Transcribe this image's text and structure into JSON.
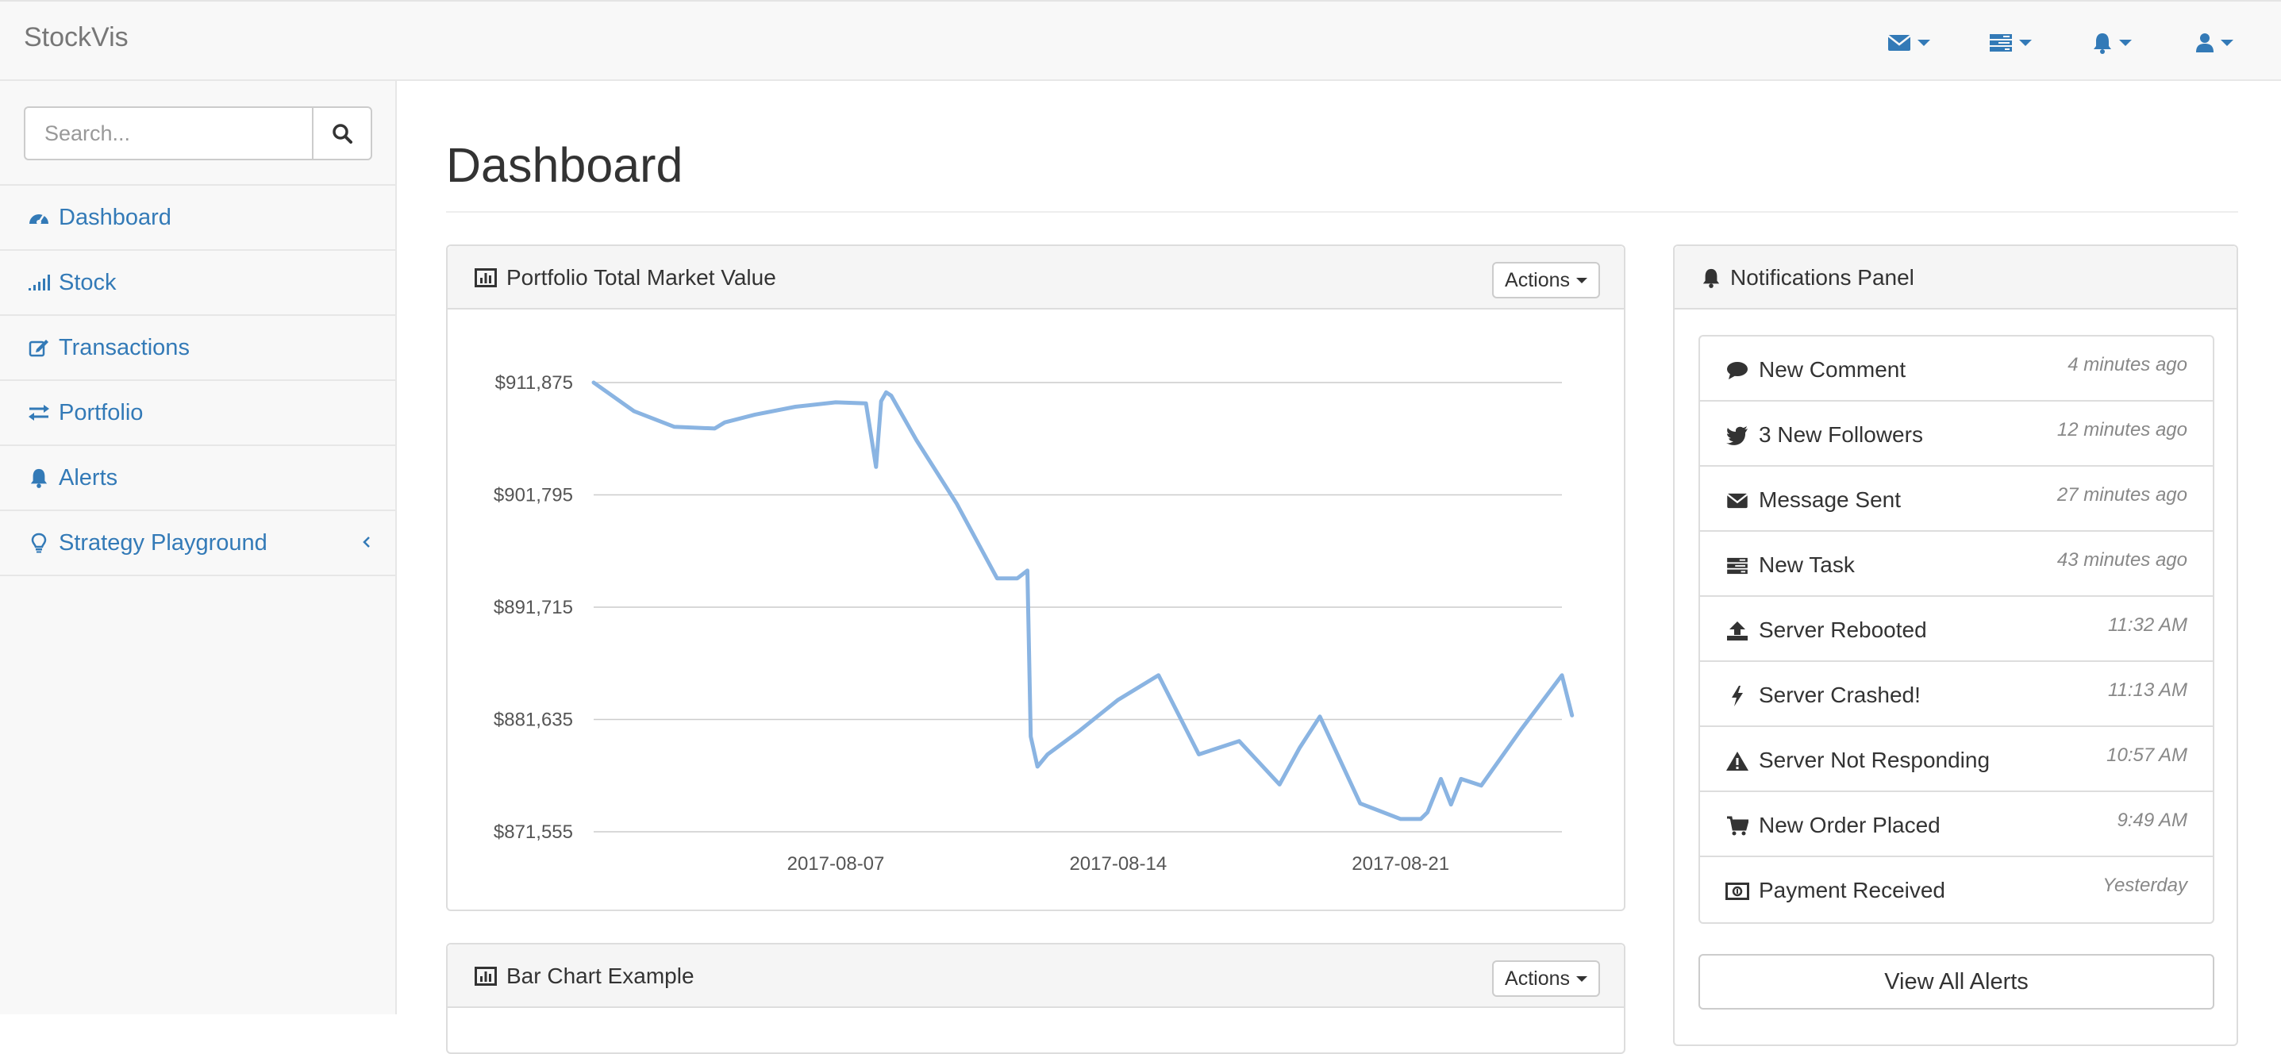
{
  "app": {
    "brand": "StockVis"
  },
  "navbar": {
    "menus": [
      {
        "icon": "envelope-icon"
      },
      {
        "icon": "tasks-icon"
      },
      {
        "icon": "bell-icon"
      },
      {
        "icon": "user-icon"
      }
    ]
  },
  "sidebar": {
    "search": {
      "placeholder": "Search...",
      "value": ""
    },
    "items": [
      {
        "label": "Dashboard",
        "icon": "dashboard-icon"
      },
      {
        "label": "Stock",
        "icon": "signal-icon"
      },
      {
        "label": "Transactions",
        "icon": "edit-icon"
      },
      {
        "label": "Portfolio",
        "icon": "exchange-icon"
      },
      {
        "label": "Alerts",
        "icon": "bell-icon"
      },
      {
        "label": "Strategy Playground",
        "icon": "lightbulb-icon",
        "collapsed_indicator": "chevron-left-icon"
      }
    ]
  },
  "main": {
    "page_title": "Dashboard",
    "panels": {
      "market_value": {
        "title": "Portfolio Total Market Value",
        "actions_label": "Actions"
      },
      "bar_chart": {
        "title": "Bar Chart Example",
        "actions_label": "Actions"
      }
    }
  },
  "notifications": {
    "title": "Notifications Panel",
    "items": [
      {
        "icon": "comment-icon",
        "text": "New Comment",
        "time": "4 minutes ago"
      },
      {
        "icon": "twitter-icon",
        "text": "3 New Followers",
        "time": "12 minutes ago"
      },
      {
        "icon": "envelope-icon",
        "text": "Message Sent",
        "time": "27 minutes ago"
      },
      {
        "icon": "tasks-icon",
        "text": "New Task",
        "time": "43 minutes ago"
      },
      {
        "icon": "upload-icon",
        "text": "Server Rebooted",
        "time": "11:32 AM"
      },
      {
        "icon": "bolt-icon",
        "text": "Server Crashed!",
        "time": "11:13 AM"
      },
      {
        "icon": "warning-icon",
        "text": "Server Not Responding",
        "time": "10:57 AM"
      },
      {
        "icon": "shopping-cart-icon",
        "text": "New Order Placed",
        "time": "9:49 AM"
      },
      {
        "icon": "money-icon",
        "text": "Payment Received",
        "time": "Yesterday"
      }
    ],
    "view_all_label": "View All Alerts"
  },
  "colors": {
    "link": "#337ab7",
    "series_line": "#8ab4e2",
    "grid": "#cccccc"
  },
  "chart_data": {
    "type": "line",
    "title": "Portfolio Total Market Value",
    "xlabel": "",
    "ylabel": "",
    "x_ticks": [
      "2017-08-07",
      "2017-08-14",
      "2017-08-21"
    ],
    "y_ticks": [
      "$871,555",
      "$881,635",
      "$891,715",
      "$901,795",
      "$911,875"
    ],
    "ylim": [
      871555,
      911875
    ],
    "xlim": [
      "2017-08-01",
      "2017-08-25"
    ],
    "grid": true,
    "series": [
      {
        "points": [
          [
            "2017-08-01",
            911875
          ],
          [
            "2017-08-02",
            909300
          ],
          [
            "2017-08-03",
            907900
          ],
          [
            "2017-08-04",
            907750
          ],
          [
            "2017-08-04 06:00",
            908300
          ],
          [
            "2017-08-05",
            909000
          ],
          [
            "2017-08-06",
            909700
          ],
          [
            "2017-08-07",
            910100
          ],
          [
            "2017-08-07 18:00",
            910000
          ],
          [
            "2017-08-08",
            904300
          ],
          [
            "2017-08-08 03:00",
            910200
          ],
          [
            "2017-08-08 06:00",
            911000
          ],
          [
            "2017-08-08 09:00",
            910700
          ],
          [
            "2017-08-09",
            906700
          ],
          [
            "2017-08-10",
            901000
          ],
          [
            "2017-08-11",
            894300
          ],
          [
            "2017-08-11 12:00",
            894300
          ],
          [
            "2017-08-11 18:00",
            895000
          ],
          [
            "2017-08-11 20:00",
            880100
          ],
          [
            "2017-08-12",
            877400
          ],
          [
            "2017-08-12 06:00",
            878500
          ],
          [
            "2017-08-13",
            880500
          ],
          [
            "2017-08-14",
            883400
          ],
          [
            "2017-08-15",
            885600
          ],
          [
            "2017-08-16",
            878500
          ],
          [
            "2017-08-17",
            879700
          ],
          [
            "2017-08-18",
            875800
          ],
          [
            "2017-08-18 12:00",
            879100
          ],
          [
            "2017-08-19",
            881900
          ],
          [
            "2017-08-20",
            874100
          ],
          [
            "2017-08-21",
            872700
          ],
          [
            "2017-08-21 12:00",
            872700
          ],
          [
            "2017-08-21 16:00",
            873300
          ],
          [
            "2017-08-22",
            876300
          ],
          [
            "2017-08-22 06:00",
            874000
          ],
          [
            "2017-08-22 12:00",
            876300
          ],
          [
            "2017-08-23",
            875700
          ],
          [
            "2017-08-24",
            880800
          ],
          [
            "2017-08-25",
            885600
          ],
          [
            "2017-08-25 06:00",
            882000
          ]
        ]
      }
    ]
  }
}
